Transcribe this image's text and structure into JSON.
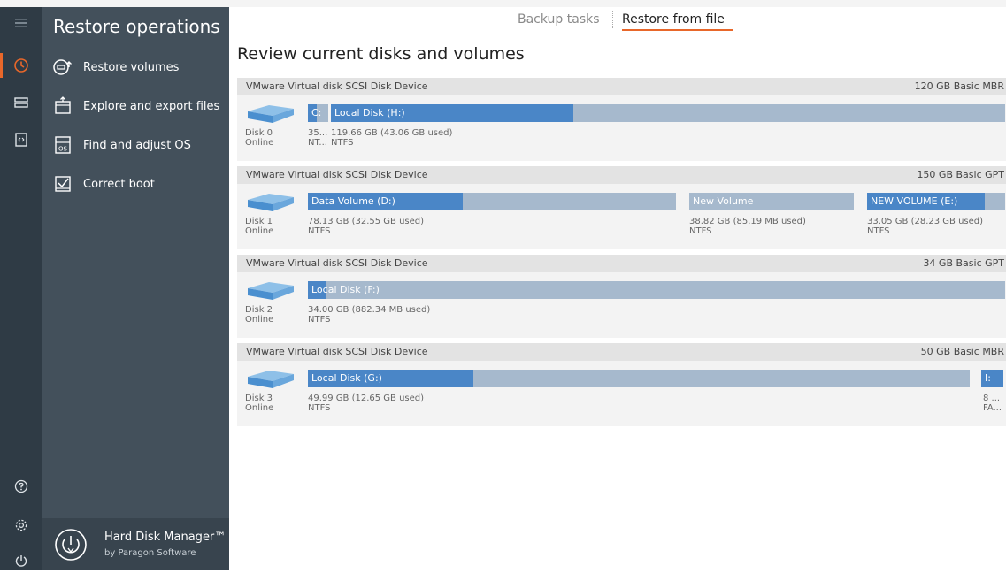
{
  "sidebar": {
    "title": "Restore operations",
    "items": [
      {
        "label": "Restore volumes",
        "icon": "restore-volumes-icon"
      },
      {
        "label": "Explore and export files",
        "icon": "explore-files-icon"
      },
      {
        "label": "Find and adjust OS",
        "icon": "os-icon"
      },
      {
        "label": "Correct boot",
        "icon": "correct-boot-icon"
      }
    ],
    "brand_name": "Hard Disk Manager™",
    "brand_sub": "by Paragon Software"
  },
  "tabs": [
    {
      "label": "Backup tasks",
      "active": false
    },
    {
      "label": "Restore from file",
      "active": true
    }
  ],
  "page_title": "Review current disks and volumes",
  "os_badge": "OS",
  "disks": [
    {
      "device": "VMware Virtual disk SCSI Disk Device",
      "size_type": "120 GB Basic MBR",
      "disk_id": "Disk 0",
      "status": "Online",
      "volumes": [
        {
          "name": "C:",
          "used_fraction": 0.45,
          "size_text": "35...",
          "fs": "NT..."
        },
        {
          "name": "Local Disk (H:)",
          "used_fraction": 0.36,
          "size_text": "119.66 GB (43.06 GB used)",
          "fs": "NTFS"
        }
      ]
    },
    {
      "device": "VMware Virtual disk SCSI Disk Device",
      "size_type": "150 GB Basic GPT",
      "disk_id": "Disk 1",
      "status": "Online",
      "volumes": [
        {
          "name": "Data Volume (D:)",
          "used_fraction": 0.42,
          "size_text": "78.13 GB (32.55 GB used)",
          "fs": "NTFS"
        },
        {
          "name": "New Volume",
          "used_fraction": 0.0,
          "size_text": "38.82 GB (85.19 MB used)",
          "fs": "NTFS"
        },
        {
          "name": "NEW VOLUME (E:)",
          "used_fraction": 0.85,
          "size_text": "33.05 GB (28.23 GB used)",
          "fs": "NTFS"
        }
      ]
    },
    {
      "device": "VMware Virtual disk SCSI Disk Device",
      "size_type": "34 GB Basic GPT",
      "disk_id": "Disk 2",
      "status": "Online",
      "volumes": [
        {
          "name": "Local Disk (F:)",
          "used_fraction": 0.026,
          "size_text": "34.00 GB (882.34 MB used)",
          "fs": "NTFS"
        }
      ]
    },
    {
      "device": "VMware Virtual disk SCSI Disk Device",
      "size_type": "50 GB Basic MBR",
      "disk_id": "Disk 3",
      "status": "Online",
      "volumes": [
        {
          "name": "Local Disk (G:)",
          "used_fraction": 0.25,
          "size_text": "49.99 GB (12.65 GB used)",
          "fs": "NTFS"
        },
        {
          "name": "I:",
          "used_fraction": 1.0,
          "size_text": "8 ...",
          "fs": "FA..."
        }
      ]
    }
  ]
}
